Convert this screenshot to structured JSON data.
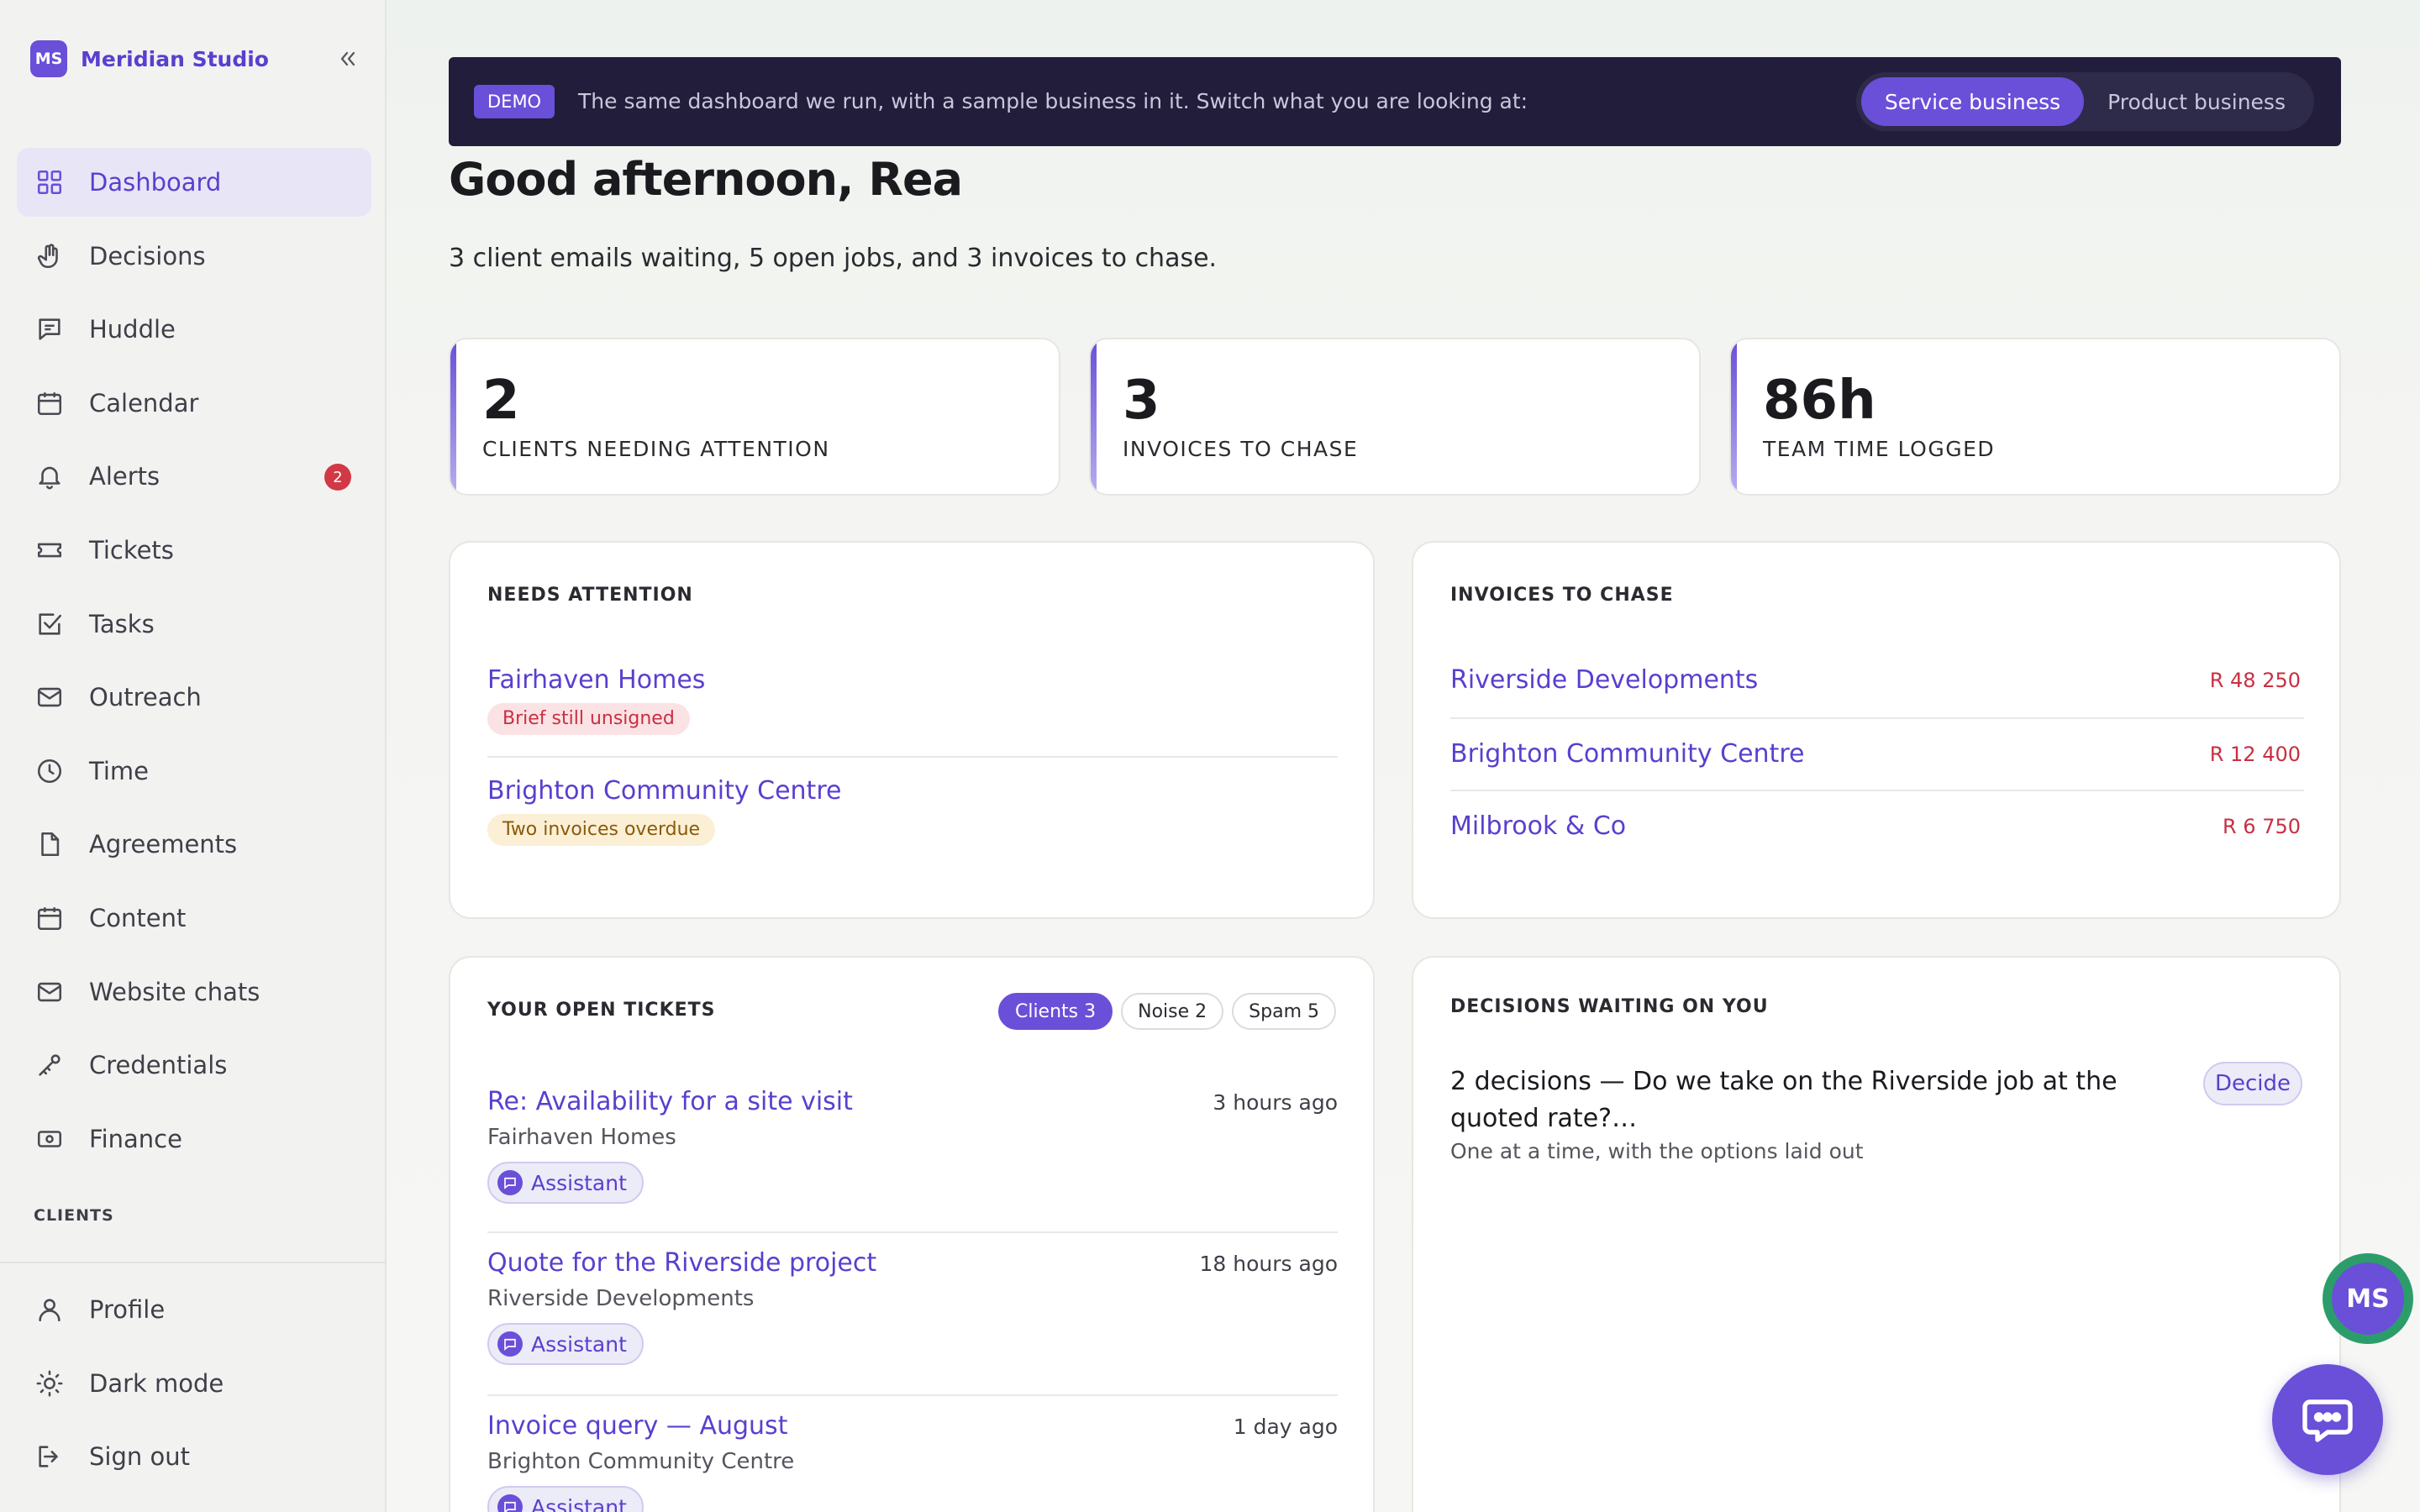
{
  "brand": {
    "initials": "MS",
    "name": "Meridian Studio"
  },
  "sidebar": {
    "collapse_icon": "double-chevron-left-icon",
    "items": [
      {
        "label": "Dashboard",
        "icon": "grid-icon",
        "active": true
      },
      {
        "label": "Decisions",
        "icon": "hand-icon"
      },
      {
        "label": "Huddle",
        "icon": "chat-square-icon"
      },
      {
        "label": "Calendar",
        "icon": "calendar-icon"
      },
      {
        "label": "Alerts",
        "icon": "bell-icon",
        "badge": "2"
      },
      {
        "label": "Tickets",
        "icon": "ticket-icon"
      },
      {
        "label": "Tasks",
        "icon": "checkbox-icon"
      },
      {
        "label": "Outreach",
        "icon": "mail-icon"
      },
      {
        "label": "Time",
        "icon": "clock-icon"
      },
      {
        "label": "Agreements",
        "icon": "document-icon"
      },
      {
        "label": "Content",
        "icon": "calendar-icon"
      },
      {
        "label": "Website chats",
        "icon": "mail-icon"
      },
      {
        "label": "Credentials",
        "icon": "key-icon"
      },
      {
        "label": "Finance",
        "icon": "banknote-icon"
      }
    ],
    "section_label": "CLIENTS",
    "bottom_items": [
      {
        "label": "Profile",
        "icon": "user-icon"
      },
      {
        "label": "Dark mode",
        "icon": "sun-icon"
      },
      {
        "label": "Sign out",
        "icon": "sign-out-icon"
      }
    ]
  },
  "demo_bar": {
    "tag": "DEMO",
    "text": "The same dashboard we run, with a sample business in it. Switch what you are looking at:",
    "options": [
      "Service business",
      "Product business"
    ],
    "selected": "Service business"
  },
  "greeting": "Good afternoon, Rea",
  "summary": "3 client emails waiting, 5 open jobs, and 3 invoices to chase.",
  "stats": [
    {
      "value": "2",
      "label": "CLIENTS NEEDING ATTENTION"
    },
    {
      "value": "3",
      "label": "INVOICES TO CHASE"
    },
    {
      "value": "86h",
      "label": "TEAM TIME LOGGED"
    }
  ],
  "needs_attention": {
    "title": "NEEDS ATTENTION",
    "items": [
      {
        "name": "Fairhaven Homes",
        "tag": "Brief still unsigned",
        "tone": "red"
      },
      {
        "name": "Brighton Community Centre",
        "tag": "Two invoices overdue",
        "tone": "amber"
      }
    ]
  },
  "invoices": {
    "title": "INVOICES TO CHASE",
    "items": [
      {
        "name": "Riverside Developments",
        "amount": "R 48 250"
      },
      {
        "name": "Brighton Community Centre",
        "amount": "R 12 400"
      },
      {
        "name": "Milbrook & Co",
        "amount": "R 6 750"
      }
    ]
  },
  "tickets": {
    "title": "YOUR OPEN TICKETS",
    "filters": [
      {
        "label": "Clients 3",
        "active": true
      },
      {
        "label": "Noise 2"
      },
      {
        "label": "Spam 5"
      }
    ],
    "items": [
      {
        "title": "Re: Availability for a site visit",
        "time": "3 hours ago",
        "client": "Fairhaven Homes",
        "assistant": "Assistant"
      },
      {
        "title": "Quote for the Riverside project",
        "time": "18 hours ago",
        "client": "Riverside Developments",
        "assistant": "Assistant"
      },
      {
        "title": "Invoice query — August",
        "time": "1 day ago",
        "client": "Brighton Community Centre",
        "assistant": "Assistant"
      }
    ]
  },
  "decisions": {
    "title": "DECISIONS WAITING ON YOU",
    "headline": "2 decisions — Do we take on the Riverside job at the quoted rate?…",
    "sub": "One at a time, with the options laid out",
    "action": "Decide"
  },
  "floating": {
    "avatar_initials": "MS",
    "chat_icon": "chat-bubble-icon"
  },
  "colors": {
    "accent": "#6a4fd9",
    "dark_bar": "#211d3a",
    "danger": "#c73042",
    "online": "#2c9d6a"
  }
}
